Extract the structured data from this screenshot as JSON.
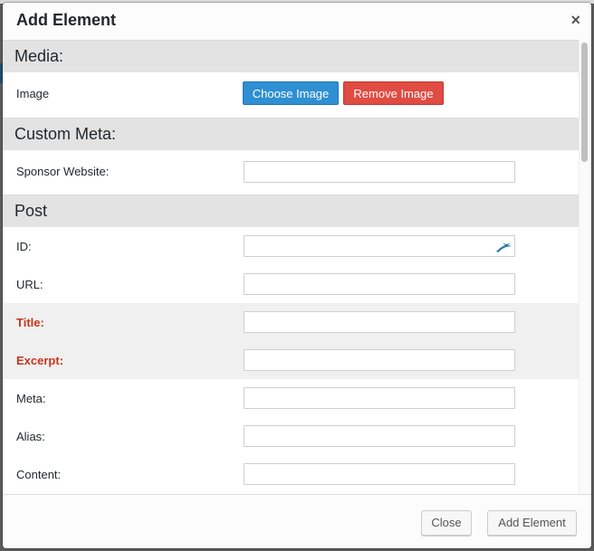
{
  "dialog": {
    "title": "Add Element",
    "close_glyph": "×"
  },
  "sections": {
    "media": {
      "header": "Media:",
      "image_label": "Image",
      "choose_button": "Choose Image",
      "remove_button": "Remove Image"
    },
    "custom_meta": {
      "header": "Custom Meta:",
      "sponsor_label": "Sponsor Website:",
      "sponsor_value": ""
    },
    "post": {
      "header": "Post",
      "fields": {
        "id": {
          "label": "ID:",
          "value": ""
        },
        "url": {
          "label": "URL:",
          "value": ""
        },
        "title": {
          "label": "Title:",
          "value": ""
        },
        "excerpt": {
          "label": "Excerpt:",
          "value": ""
        },
        "meta": {
          "label": "Meta:",
          "value": ""
        },
        "alias": {
          "label": "Alias:",
          "value": ""
        },
        "content": {
          "label": "Content:",
          "value": ""
        }
      }
    }
  },
  "footer": {
    "close_label": "Close",
    "add_label": "Add Element"
  },
  "colors": {
    "choose_button": "#2e8fd2",
    "remove_button": "#e04b42",
    "required_label": "#c5361b",
    "section_header": "#e3e3e3"
  },
  "icons": {
    "id_field": "gazelle-icon",
    "dialog_close": "close-icon"
  }
}
